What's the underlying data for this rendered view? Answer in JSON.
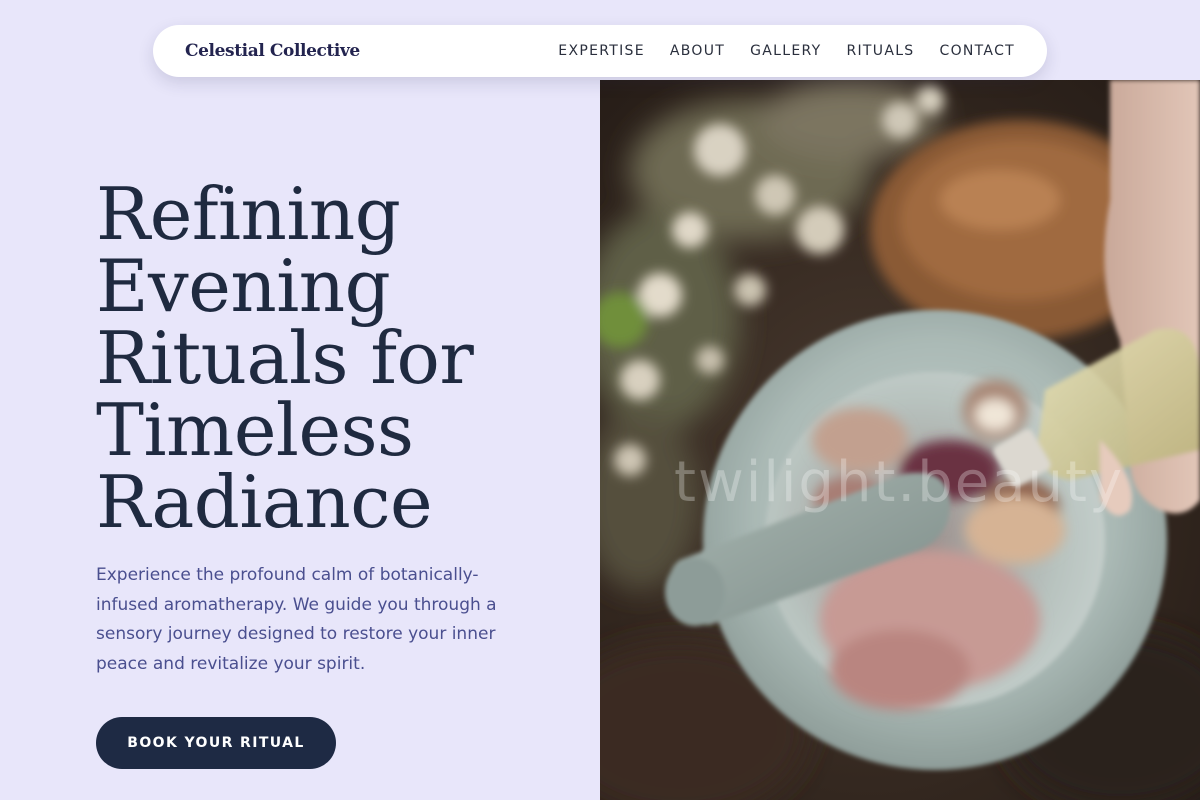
{
  "header": {
    "brand": "Celestial Collective",
    "nav": [
      {
        "label": "EXPERTISE"
      },
      {
        "label": "ABOUT"
      },
      {
        "label": "GALLERY"
      },
      {
        "label": "RITUALS"
      },
      {
        "label": "CONTACT"
      }
    ]
  },
  "hero": {
    "title_lines": [
      "Refining",
      "Evening",
      "Rituals for",
      "Timeless",
      "Radiance"
    ],
    "description": "Experience the profound calm of botanically-infused aromatherapy. We guide you through a sensory journey designed to restore your inner peace and revitalize your spirit.",
    "cta_label": "BOOK YOUR RITUAL"
  },
  "image": {
    "watermark": "twilight.beauty",
    "subject": "mortar-and-pestle-with-dried-petals-and-oil-bottle"
  },
  "colors": {
    "background": "#e8e6fa",
    "nav_background": "#ffffff",
    "heading": "#1f2a40",
    "body_text": "#4a4f8f",
    "button": "#1e2a44",
    "button_text": "#ffffff"
  }
}
